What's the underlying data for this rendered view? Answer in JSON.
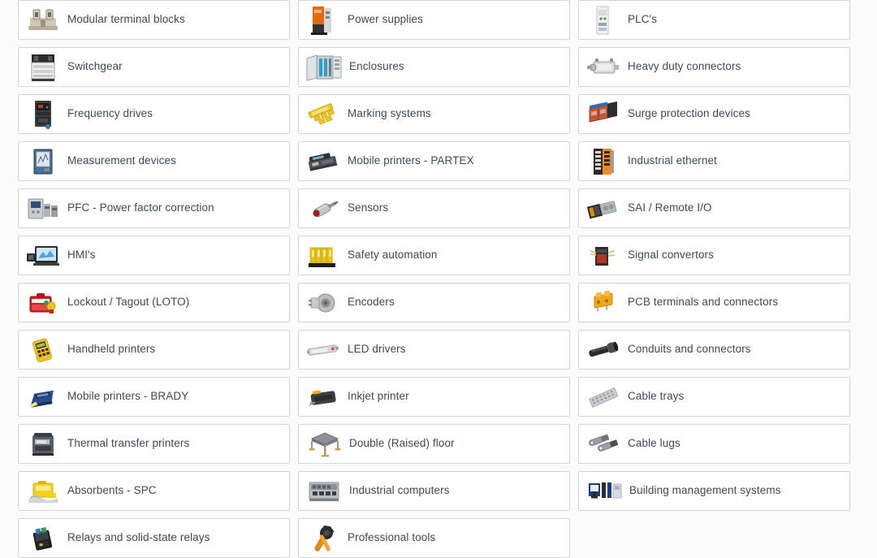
{
  "page": {
    "title": "Product category grid",
    "background_color": "#fbfbfc",
    "card_background": "#ffffff",
    "card_border_color": "#d6d6d6",
    "label_color": "#3b4a5a",
    "columns": 3,
    "rows": 13
  },
  "categories": [
    {
      "label": "Modular terminal blocks",
      "icon": "terminal-block-icon",
      "icon_colors": [
        "#cfc6b4",
        "#8c8madd",
        "#6b6b6b"
      ],
      "spacing": "loose"
    },
    {
      "label": "Power supplies",
      "icon": "power-supply-icon",
      "icon_colors": [
        "#e8690b",
        "#3a3a3a",
        "#d9d9d9"
      ],
      "spacing": "loose"
    },
    {
      "label": "PLC's",
      "icon": "plc-icon",
      "icon_colors": [
        "#e9eef0",
        "#5a8a3a",
        "#9aa6ad"
      ],
      "spacing": "loose"
    },
    {
      "label": "Switchgear",
      "icon": "switchgear-icon",
      "icon_colors": [
        "#2a2a2a",
        "#f2f2f2",
        "#8a8a8a"
      ],
      "spacing": "loose"
    },
    {
      "label": "Enclosures",
      "icon": "enclosure-icon",
      "icon_colors": [
        "#d8dde0",
        "#2aa3c4",
        "#6d7a82"
      ],
      "spacing": "tight"
    },
    {
      "label": "Heavy duty connectors",
      "icon": "heavy-duty-connector-icon",
      "icon_colors": [
        "#d4d7d9",
        "#8e9499",
        "#5f6569"
      ],
      "spacing": "loose"
    },
    {
      "label": "Frequency drives",
      "icon": "frequency-drive-icon",
      "icon_colors": [
        "#3b3f42",
        "#1b1d1f",
        "#2f7fb5"
      ],
      "spacing": "loose"
    },
    {
      "label": "Marking systems",
      "icon": "marking-system-icon",
      "icon_colors": [
        "#f2c21c",
        "#e3b000",
        "#8a7200"
      ],
      "spacing": "loose"
    },
    {
      "label": "Surge protection devices",
      "icon": "surge-protection-icon",
      "icon_colors": [
        "#c0563a",
        "#2f6fb0",
        "#2e2e2e"
      ],
      "spacing": "loose"
    },
    {
      "label": "Measurement devices",
      "icon": "measurement-device-icon",
      "icon_colors": [
        "#4a6a86",
        "#cdd6dd",
        "#24405a"
      ],
      "spacing": "loose"
    },
    {
      "label": "Mobile printers - PARTEX",
      "icon": "mobile-printer-partex-icon",
      "icon_colors": [
        "#4c5157",
        "#2b2f33",
        "#b9bec2"
      ],
      "spacing": "loose"
    },
    {
      "label": "Industrial ethernet",
      "icon": "industrial-ethernet-icon",
      "icon_colors": [
        "#2b2b2b",
        "#f08a1c",
        "#d9d9d9"
      ],
      "spacing": "loose"
    },
    {
      "label": "PFC - Power factor correction",
      "icon": "pfc-icon",
      "icon_colors": [
        "#c9ccd0",
        "#7e858b",
        "#2f4f74"
      ],
      "spacing": "loose"
    },
    {
      "label": "Sensors",
      "icon": "sensor-icon",
      "icon_colors": [
        "#c3c7ca",
        "#8e9296",
        "#a01f1f"
      ],
      "spacing": "loose"
    },
    {
      "label": "SAI / Remote I/O",
      "icon": "sai-remote-io-icon",
      "icon_colors": [
        "#2b2b2b",
        "#e8880e",
        "#b5babd"
      ],
      "spacing": "loose"
    },
    {
      "label": "HMI's",
      "icon": "hmi-icon",
      "icon_colors": [
        "#2a2f34",
        "#4aa8d8",
        "#cfe6f2"
      ],
      "spacing": "loose"
    },
    {
      "label": "Safety automation",
      "icon": "safety-automation-icon",
      "icon_colors": [
        "#e8c31a",
        "#c8a400",
        "#1e1e1e"
      ],
      "spacing": "loose"
    },
    {
      "label": "Signal convertors",
      "icon": "signal-convertor-icon",
      "icon_colors": [
        "#2f2f2f",
        "#b4341f",
        "#d8c98a"
      ],
      "spacing": "loose"
    },
    {
      "label": "Lockout / Tagout (LOTO)",
      "icon": "lockout-tagout-icon",
      "icon_colors": [
        "#cc1f1f",
        "#e84a4a",
        "#f2c21c"
      ],
      "spacing": "loose"
    },
    {
      "label": "Encoders",
      "icon": "encoder-icon",
      "icon_colors": [
        "#b9bec2",
        "#8a9095",
        "#5f6468"
      ],
      "spacing": "loose"
    },
    {
      "label": "PCB terminals and connectors",
      "icon": "pcb-terminal-icon",
      "icon_colors": [
        "#f0a818",
        "#d88f00",
        "#a86c00"
      ],
      "spacing": "loose"
    },
    {
      "label": "Handheld printers",
      "icon": "handheld-printer-icon",
      "icon_colors": [
        "#f2c21c",
        "#2b2b2b",
        "#8a7200"
      ],
      "spacing": "loose"
    },
    {
      "label": "LED drivers",
      "icon": "led-driver-icon",
      "icon_colors": [
        "#d6dadd",
        "#9aa0a5",
        "#e04a4a"
      ],
      "spacing": "loose"
    },
    {
      "label": "Conduits and connectors",
      "icon": "conduit-icon",
      "icon_colors": [
        "#2b2b2b",
        "#4a4a4a",
        "#6b6b6b"
      ],
      "spacing": "loose"
    },
    {
      "label": "Mobile printers - BRADY",
      "icon": "mobile-printer-brady-icon",
      "icon_colors": [
        "#2b4a8c",
        "#1b2f5c",
        "#f2e08a"
      ],
      "spacing": "loose"
    },
    {
      "label": "Inkjet printer",
      "icon": "inkjet-printer-icon",
      "icon_colors": [
        "#3b3f42",
        "#2a2d30",
        "#f0a818"
      ],
      "spacing": "loose"
    },
    {
      "label": "Cable trays",
      "icon": "cable-tray-icon",
      "icon_colors": [
        "#c8ccd0",
        "#9aa0a5",
        "#7b8085"
      ],
      "spacing": "loose"
    },
    {
      "label": "Thermal transfer printers",
      "icon": "thermal-transfer-printer-icon",
      "icon_colors": [
        "#5a6068",
        "#3a3f45",
        "#b9bec2"
      ],
      "spacing": "loose"
    },
    {
      "label": "Double (Raised) floor",
      "icon": "raised-floor-icon",
      "icon_colors": [
        "#8b9196",
        "#5f6469",
        "#c7a45a"
      ],
      "spacing": "tight"
    },
    {
      "label": "Cable lugs",
      "icon": "cable-lug-icon",
      "icon_colors": [
        "#9aa0a6",
        "#6e747a",
        "#4a5055"
      ],
      "spacing": "loose"
    },
    {
      "label": "Absorbents - SPC",
      "icon": "absorbent-icon",
      "icon_colors": [
        "#f2d21c",
        "#d8b800",
        "#cfd6da"
      ],
      "spacing": "loose"
    },
    {
      "label": "Industrial computers",
      "icon": "industrial-computer-icon",
      "icon_colors": [
        "#b9bec2",
        "#8a9095",
        "#3a3f45"
      ],
      "spacing": "tight"
    },
    {
      "label": "Building management systems",
      "icon": "building-management-icon",
      "icon_colors": [
        "#1f3a8a",
        "#2b2b2b",
        "#d9dde1"
      ],
      "spacing": "tight"
    },
    {
      "label": "Relays and solid-state relays",
      "icon": "relay-icon",
      "icon_colors": [
        "#1e1e1e",
        "#3a3f45",
        "#2f7fb5"
      ],
      "spacing": "loose"
    },
    {
      "label": "Professional tools",
      "icon": "professional-tool-icon",
      "icon_colors": [
        "#e8880e",
        "#2b2b2b",
        "#4a4a4a"
      ],
      "spacing": "loose"
    },
    {
      "label": "",
      "icon": "",
      "icon_colors": [],
      "spacing": "loose"
    }
  ]
}
